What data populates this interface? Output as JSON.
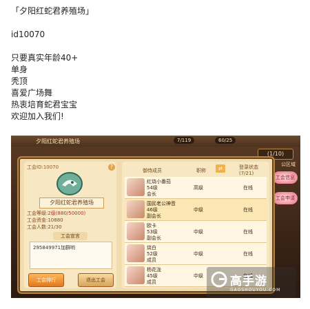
{
  "post": {
    "line1": "「夕阳红蛇君养殖场」",
    "line2": "id10070",
    "line3": "只要真实年龄40+",
    "line4": "单身",
    "line5": "秃顶",
    "line6": "喜爱广场舞",
    "line7": "热衷培育蛇君宝宝",
    "line8": "欢迎加入我们!"
  },
  "game": {
    "topbar_guild": "夕阳红蛇君养殖场",
    "res1": "7/119",
    "res2": "60/25",
    "page": "(1/10)",
    "side_tab": "公区域",
    "side_btn1": "工会信息",
    "side_btn2": "工会申请",
    "guild_id": "工会ID:10070",
    "help": "?",
    "guild_name": "夕阳红蛇君养殖场",
    "stat_level_label": "工会等级:",
    "stat_level_value": "2级(880/50000)",
    "stat_fund": "工会资金:10880",
    "stat_members": "工会人数:21/30",
    "notice_title": "工会宣言",
    "notice_text": "295849971加群哟",
    "btn_left": "工会排行",
    "btn_right": "退出工会",
    "col_name": "御侍成员",
    "col_pos": "职称",
    "col_status": "登录状态",
    "col_status_count": "(7/21)",
    "members": [
      {
        "name": "红烧小番茄",
        "level": "54级",
        "role": "会长",
        "pos": "高级",
        "status": "在线"
      },
      {
        "name": "国民老公神音",
        "level": "46级",
        "role": "副会长",
        "pos": "中级",
        "status": "在线"
      },
      {
        "name": "欧卡",
        "level": "53级",
        "role": "副会长",
        "pos": "中级",
        "status": "在线"
      },
      {
        "name": "烧白",
        "level": "52级",
        "role": "成员",
        "pos": "中级",
        "status": "在线"
      },
      {
        "name": "杨花泷",
        "level": "45级",
        "role": "成员",
        "pos": "中级",
        "status": "在线"
      }
    ],
    "tabs": [
      "工会信息",
      "工会排行",
      "工会活动",
      "工会申请"
    ]
  },
  "watermark": {
    "cn": "高手游",
    "en": "GAOSHOUYOU.COM"
  }
}
